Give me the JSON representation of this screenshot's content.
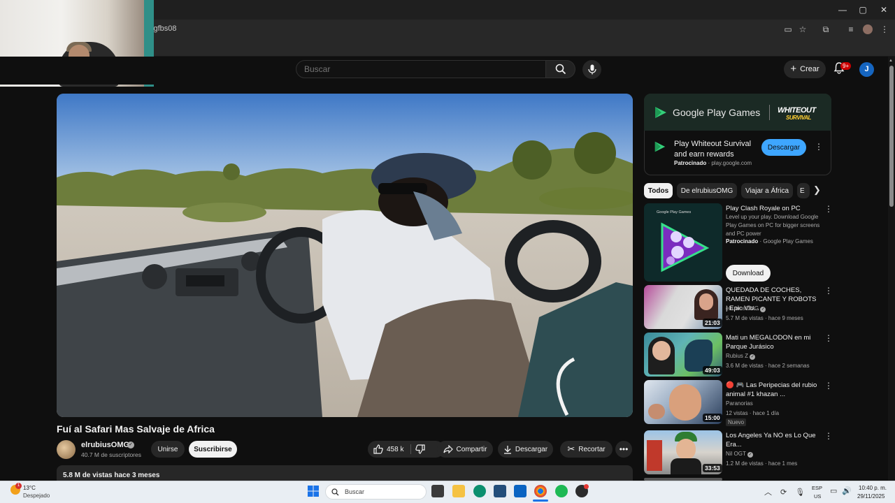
{
  "browser": {
    "url": "cgfbs08",
    "window_controls": [
      "minimize",
      "maximize",
      "close"
    ]
  },
  "header": {
    "search_placeholder": "Buscar",
    "create_label": "Crear",
    "notif_badge": "9+",
    "avatar_letter": "J"
  },
  "video": {
    "title": "Fuí al Safari Mas Salvaje de Africa",
    "channel": "elrubiusOMG",
    "subscribers": "40.7 M de suscriptores",
    "join_label": "Unirse",
    "subscribe_label": "Suscribirse",
    "likes": "458 k",
    "share_label": "Compartir",
    "download_label": "Descargar",
    "clip_label": "Recortar",
    "stats": "5.8 M de vistas  hace 3 meses"
  },
  "ad": {
    "brand": "Google Play Games",
    "partner_line1": "WHITEOUT",
    "partner_line2": "SURVIVAL",
    "title": "Play Whiteout Survival and earn rewards",
    "sponsored": "Patrocinado",
    "domain": "play.google.com",
    "cta": "Descargar"
  },
  "chips": [
    "Todos",
    "De elrubiusOMG",
    "Viajar a África",
    "E"
  ],
  "recommendations": [
    {
      "title": "Play Clash Royale on PC",
      "desc": "Level up your play. Download Google Play Games on PC for bigger screens and PC power",
      "sponsored": "Patrocinado",
      "advertiser": "Google Play Games",
      "cta": "Download",
      "thumb_label": "Google Play Games"
    },
    {
      "title": "QUEDADA DE COCHES, RAMEN PICANTE Y ROBOTS | Epic Vlo...",
      "channel": "elrubiusOMG",
      "views": "5.7 M de vistas",
      "age": "hace 9 meses",
      "duration": "21:03"
    },
    {
      "title": "Mati un MEGALODON en mi Parque Jurásico",
      "channel": "Rubius Z",
      "views": "3.6 M de vistas",
      "age": "hace 2 semanas",
      "duration": "49:03"
    },
    {
      "title": "🔴 🎮 Las Peripecias del rubio animal #1   khazan ...",
      "channel": "Paranorias",
      "views": "12 vistas",
      "age": "hace 1 día",
      "duration": "15:00",
      "badge": "Nuevo"
    },
    {
      "title": "Los Angeles Ya NO es Lo Que Era...",
      "channel": "Nil OGT",
      "views": "1.2 M de vistas",
      "age": "hace 1 mes",
      "duration": "33:53"
    }
  ],
  "taskbar": {
    "temp": "13°C",
    "weather": "Despejado",
    "weather_badge": "1",
    "search_label": "Buscar",
    "lang_top": "ESP",
    "lang_bottom": "US",
    "time": "10:40 p. m.",
    "date": "29/11/2025"
  },
  "colors": {
    "background": "#0f0f0f",
    "accent_blue": "#3ea6ff",
    "notification_red": "#cc0000"
  }
}
